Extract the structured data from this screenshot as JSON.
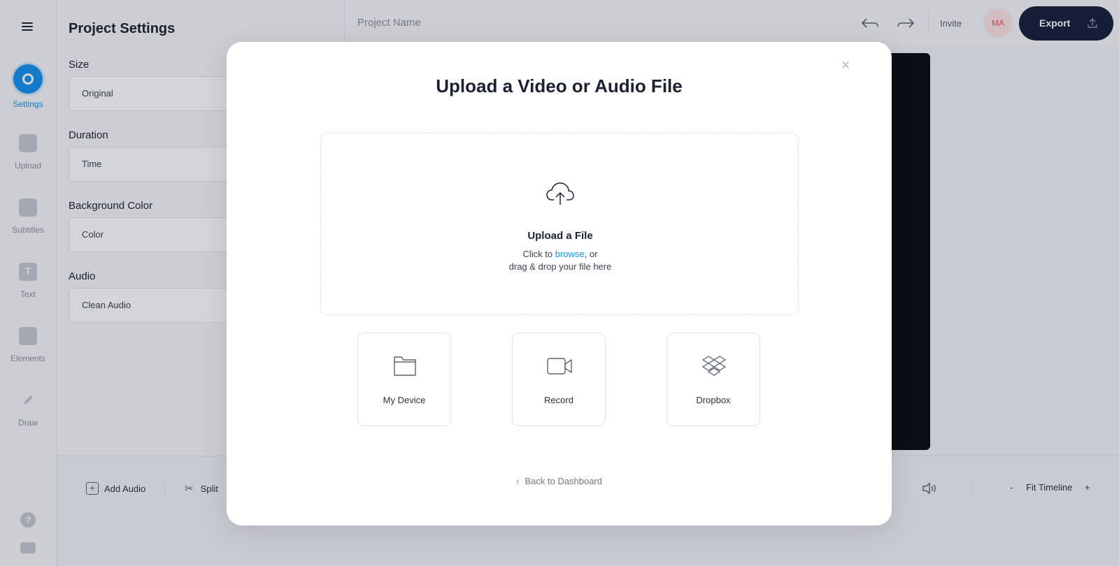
{
  "rail": {
    "items": [
      {
        "label": "Settings",
        "icon": "settings-icon",
        "active": true
      },
      {
        "label": "Upload",
        "icon": "image-icon"
      },
      {
        "label": "Subtitles",
        "icon": "subtitles-icon"
      },
      {
        "label": "Text",
        "icon": "text-icon",
        "glyph": "T"
      },
      {
        "label": "Elements",
        "icon": "elements-icon"
      },
      {
        "label": "Draw",
        "icon": "pencil-icon"
      }
    ],
    "help_glyph": "?"
  },
  "panel": {
    "title": "Project Settings",
    "size_label": "Size",
    "size_value": "Original",
    "duration_label": "Duration",
    "duration_value": "Time",
    "bg_label": "Background Color",
    "bg_value": "Color",
    "audio_label": "Audio",
    "audio_value": "Clean Audio"
  },
  "topbar": {
    "project_name": "Project Name",
    "invite": "Invite",
    "avatar_initials": "MA",
    "export": "Export"
  },
  "bottombar": {
    "add_audio": "Add Audio",
    "split": "Split",
    "zoom_minus": "-",
    "fit_timeline": "Fit Timeline",
    "zoom_plus": "+"
  },
  "modal": {
    "title": "Upload a Video or Audio File",
    "close": "×",
    "dropzone_title": "Upload a File",
    "dropzone_click_prefix": "Click to ",
    "dropzone_browse": "browse",
    "dropzone_click_suffix": ", or",
    "dropzone_line2": "drag & drop your file here",
    "sources": [
      {
        "label": "My Device",
        "icon": "folder-icon"
      },
      {
        "label": "Record",
        "icon": "video-camera-icon"
      },
      {
        "label": "Dropbox",
        "icon": "dropbox-icon"
      }
    ],
    "back": "Back to Dashboard"
  },
  "colors": {
    "accent": "#1691ee",
    "export_bg": "#16203a",
    "avatar_bg": "#fde3e3",
    "avatar_text": "#e05a5a"
  }
}
